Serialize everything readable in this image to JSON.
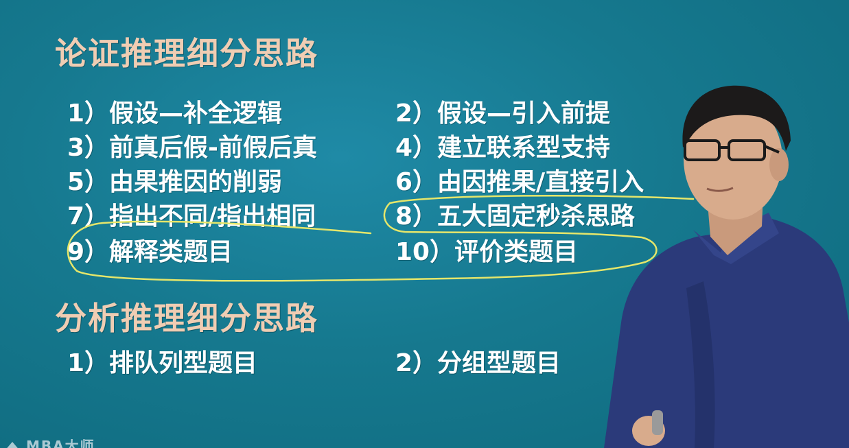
{
  "board": {
    "background_color": "#16798f",
    "heading_color": "#f0cdb3",
    "item_color": "#ffffff",
    "annotation_color": "#e6e66a"
  },
  "section1": {
    "title": "论证推理细分思路",
    "items": [
      "1）假设—补全逻辑",
      "2）假设—引入前提",
      "3）前真后假-前假后真",
      "4）建立联系型支持",
      "5）由果推因的削弱",
      "6）由因推果/直接引入",
      "7）指出不同/指出相同",
      "8）五大固定秒杀思路",
      "9）解释类题目",
      "10）评价类题目"
    ]
  },
  "section2": {
    "title": "分析推理细分思路",
    "items": [
      "1）排队列型题目",
      "2）分组型题目"
    ]
  },
  "watermark": {
    "text": "MBA大师",
    "logo_icon": "mba-logo-icon"
  },
  "presenter": {
    "description_icon": "presenter-figure"
  }
}
